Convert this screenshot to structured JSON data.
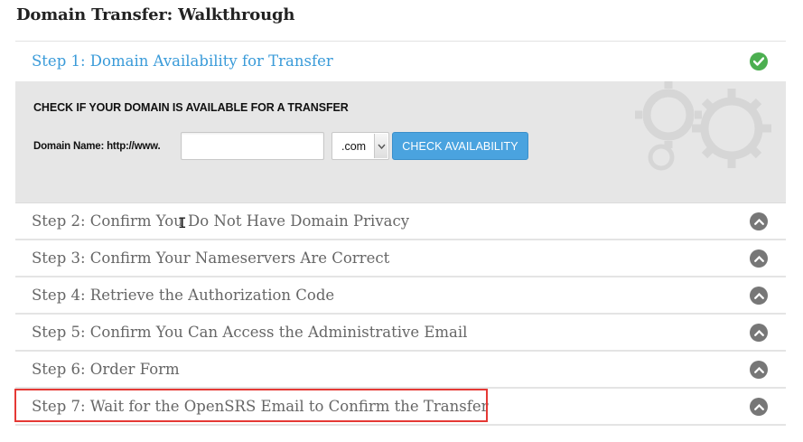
{
  "page": {
    "title": "Domain Transfer: Walkthrough"
  },
  "steps": [
    {
      "label": "Step 1: Domain Availability for Transfer",
      "state": "complete",
      "icon": "check-circle-icon"
    },
    {
      "label": "Step 2: Confirm You Do Not Have Domain Privacy",
      "icon": "chevron-up-icon"
    },
    {
      "label": "Step 3: Confirm Your Nameservers Are Correct",
      "icon": "chevron-up-icon"
    },
    {
      "label": "Step 4: Retrieve the Authorization Code",
      "icon": "chevron-up-icon"
    },
    {
      "label": "Step 5: Confirm You Can Access the Administrative Email",
      "icon": "chevron-up-icon"
    },
    {
      "label": "Step 6: Order Form",
      "icon": "chevron-up-icon"
    },
    {
      "label": "Step 7: Wait for the OpenSRS Email to Confirm the Transfer",
      "icon": "chevron-up-icon",
      "highlighted": true
    }
  ],
  "availability": {
    "heading": "CHECK IF YOUR DOMAIN IS AVAILABLE FOR A TRANSFER",
    "field_label": "Domain Name: http://www.",
    "domain_value": "",
    "tld_selected": ".com",
    "button_label": "CHECK AVAILABILITY"
  },
  "colors": {
    "accent_blue": "#3a9bd9",
    "button_blue": "#4aa3df",
    "complete_green": "#4caf50",
    "highlight_red": "#e53935"
  }
}
